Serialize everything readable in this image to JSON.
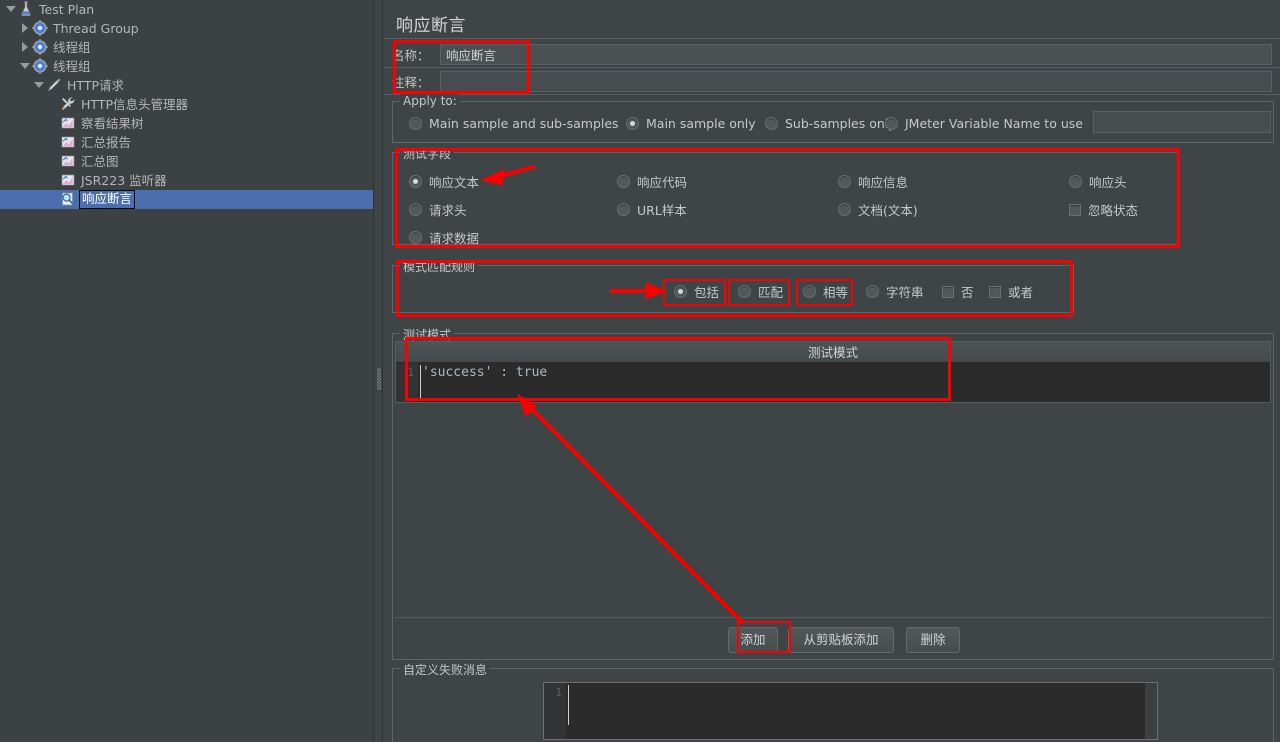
{
  "window": {
    "title": "响应断言"
  },
  "sidebar": {
    "items": [
      {
        "label": "Test Plan",
        "indent": 0,
        "twisty": "down",
        "icon": "test-plan-icon",
        "selected": false
      },
      {
        "label": "Thread Group",
        "indent": 1,
        "twisty": "right",
        "icon": "thread-group-icon",
        "selected": false
      },
      {
        "label": "线程组",
        "indent": 1,
        "twisty": "right",
        "icon": "thread-group-icon",
        "selected": false
      },
      {
        "label": "线程组",
        "indent": 1,
        "twisty": "down",
        "icon": "thread-group-icon",
        "selected": false
      },
      {
        "label": "HTTP请求",
        "indent": 2,
        "twisty": "down",
        "icon": "http-request-icon",
        "selected": false
      },
      {
        "label": "HTTP信息头管理器",
        "indent": 3,
        "twisty": "none",
        "icon": "header-manager-icon",
        "selected": false
      },
      {
        "label": "察看结果树",
        "indent": 3,
        "twisty": "none",
        "icon": "listener-icon",
        "selected": false
      },
      {
        "label": "汇总报告",
        "indent": 3,
        "twisty": "none",
        "icon": "listener-icon",
        "selected": false
      },
      {
        "label": "汇总图",
        "indent": 3,
        "twisty": "none",
        "icon": "listener-icon",
        "selected": false
      },
      {
        "label": "JSR223 监听器",
        "indent": 3,
        "twisty": "none",
        "icon": "listener-icon",
        "selected": false
      },
      {
        "label": "响应断言",
        "indent": 3,
        "twisty": "none",
        "icon": "assertion-icon",
        "selected": true
      }
    ]
  },
  "form": {
    "name_label": "名称：",
    "name_value": "响应断言",
    "comment_label": "注释：",
    "comment_value": ""
  },
  "apply_to": {
    "title": "Apply to:",
    "options": [
      {
        "label": "Main sample and sub-samples",
        "selected": false
      },
      {
        "label": "Main sample only",
        "selected": true
      },
      {
        "label": "Sub-samples only",
        "selected": false
      },
      {
        "label": "JMeter Variable Name to use",
        "selected": false
      }
    ],
    "variable_value": ""
  },
  "test_field": {
    "title": "测试字段",
    "options": [
      {
        "label": "响应文本",
        "type": "radio",
        "selected": true
      },
      {
        "label": "响应代码",
        "type": "radio",
        "selected": false
      },
      {
        "label": "响应信息",
        "type": "radio",
        "selected": false
      },
      {
        "label": "响应头",
        "type": "radio",
        "selected": false
      },
      {
        "label": "请求头",
        "type": "radio",
        "selected": false
      },
      {
        "label": "URL样本",
        "type": "radio",
        "selected": false
      },
      {
        "label": "文档(文本)",
        "type": "radio",
        "selected": false
      },
      {
        "label": "忽略状态",
        "type": "checkbox",
        "selected": false
      },
      {
        "label": "请求数据",
        "type": "radio",
        "selected": false
      }
    ]
  },
  "pattern_rules": {
    "title": "模式匹配规则",
    "options": [
      {
        "label": "包括",
        "type": "radio",
        "selected": true
      },
      {
        "label": "匹配",
        "type": "radio",
        "selected": false
      },
      {
        "label": "相等",
        "type": "radio",
        "selected": false
      },
      {
        "label": "字符串",
        "type": "radio",
        "selected": false
      },
      {
        "label": "否",
        "type": "checkbox",
        "selected": false
      },
      {
        "label": "或者",
        "type": "checkbox",
        "selected": false
      }
    ]
  },
  "test_pattern": {
    "group_title": "测试模式",
    "table_header": "测试模式",
    "line_number": "1",
    "code": "'success' : true",
    "buttons": {
      "add": "添加",
      "add_from_clipboard": "从剪贴板添加",
      "delete": "删除"
    }
  },
  "custom_failure": {
    "title": "自定义失败消息",
    "line_number": "1",
    "value": ""
  },
  "annotations": {
    "highlight_color": "#fb0000",
    "arrows": [
      {
        "name": "arrow-to-response-text"
      },
      {
        "name": "arrow-to-include-option"
      },
      {
        "name": "arrow-from-add-button-to-test-pattern"
      }
    ]
  },
  "colors": {
    "background": "#3f4447",
    "tree_background": "#3c4143",
    "selection": "#4b6eaf",
    "editor_background": "#2b2b2b",
    "code_text": "#a9b7c6",
    "accent_red": "#fb0000"
  }
}
